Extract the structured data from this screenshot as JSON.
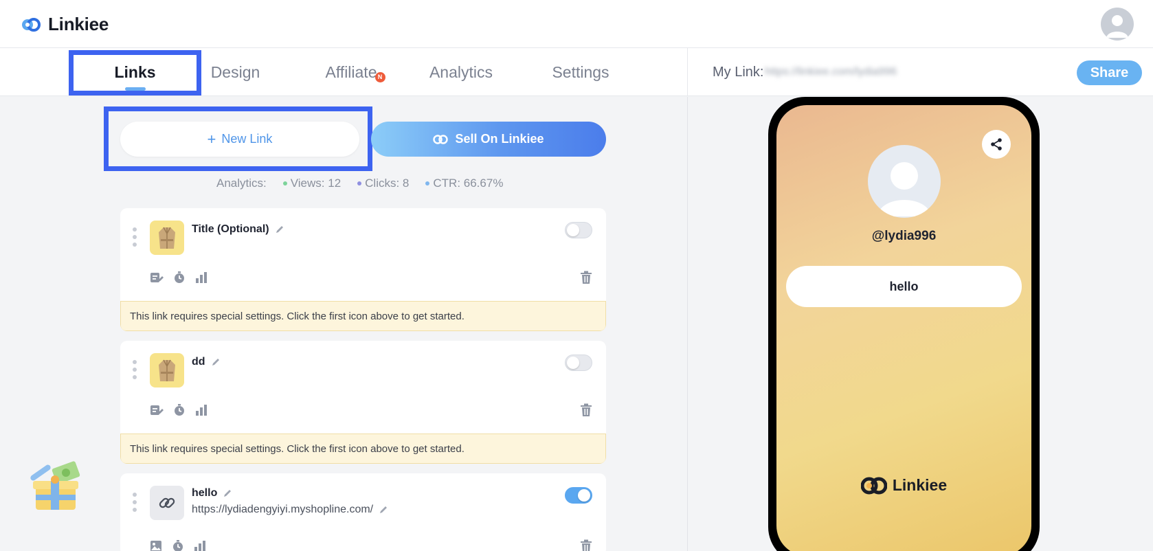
{
  "header": {
    "brand": "Linkiee"
  },
  "tabs": [
    {
      "label": "Links"
    },
    {
      "label": "Design"
    },
    {
      "label": "Affiliate",
      "badge": "N"
    },
    {
      "label": "Analytics"
    },
    {
      "label": "Settings"
    }
  ],
  "mylink": {
    "label": "My Link:",
    "url": "https://linkiee.com/lydia996",
    "share_label": "Share"
  },
  "actions": {
    "new_link_icon": "+",
    "new_link_label": "New Link",
    "sell_label": "Sell On Linkiee"
  },
  "analytics": {
    "label": "Analytics:",
    "views": "Views: 12",
    "clicks": "Clicks: 8",
    "ctr": "CTR: 66.67%",
    "colors": {
      "views": "#7cd39a",
      "clicks": "#8f8fe0",
      "ctr": "#7fb6ee"
    }
  },
  "cards": [
    {
      "title": "Title (Optional)",
      "enabled": false,
      "thumb": "coat-icon",
      "notice": "This link requires special settings. Click the first icon above to get started."
    },
    {
      "title": "dd",
      "enabled": false,
      "thumb": "coat-icon",
      "notice": "This link requires special settings. Click the first icon above to get started."
    },
    {
      "title": "hello",
      "url": "https://lydiadengyiyi.myshopline.com/",
      "enabled": true,
      "thumb": "link-icon"
    }
  ],
  "preview": {
    "handle": "@lydia996",
    "link_button": "hello",
    "brand": "Linkiee"
  },
  "colors": {
    "accent": "#4f95e8",
    "highlight": "#3d63f0",
    "share": "#69b3f2"
  }
}
